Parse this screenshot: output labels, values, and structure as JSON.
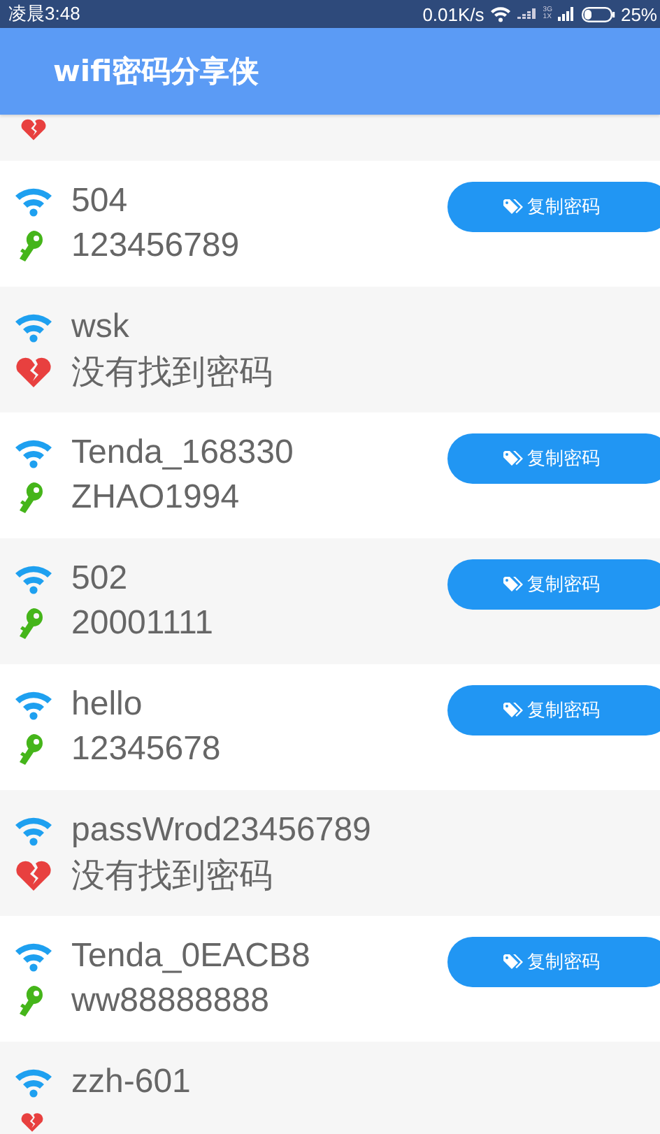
{
  "status_bar": {
    "time": "凌晨3:48",
    "speed": "0.01K/s",
    "network_top": "3G",
    "network_bottom": "1X",
    "battery": "25%"
  },
  "app_bar": {
    "title": "wifi密码分享侠"
  },
  "networks": [
    {
      "kind": "not_found"
    },
    {
      "kind": "found",
      "ssid": "504",
      "password": "123456789",
      "button": "复制密码"
    },
    {
      "kind": "not_found",
      "ssid": "wsk",
      "password": "没有找到密码"
    },
    {
      "kind": "found",
      "ssid": "Tenda_168330",
      "password": "ZHAO1994",
      "button": "复制密码"
    },
    {
      "kind": "found",
      "ssid": "502",
      "password": "20001111",
      "button": "复制密码"
    },
    {
      "kind": "found",
      "ssid": "hello",
      "password": "12345678",
      "button": "复制密码"
    },
    {
      "kind": "not_found",
      "ssid": "passWrod23456789",
      "password": "没有找到密码"
    },
    {
      "kind": "found",
      "ssid": "Tenda_0EACB8",
      "password": "ww88888888",
      "button": "复制密码"
    },
    {
      "kind": "not_found",
      "ssid": "zzh-601"
    }
  ]
}
